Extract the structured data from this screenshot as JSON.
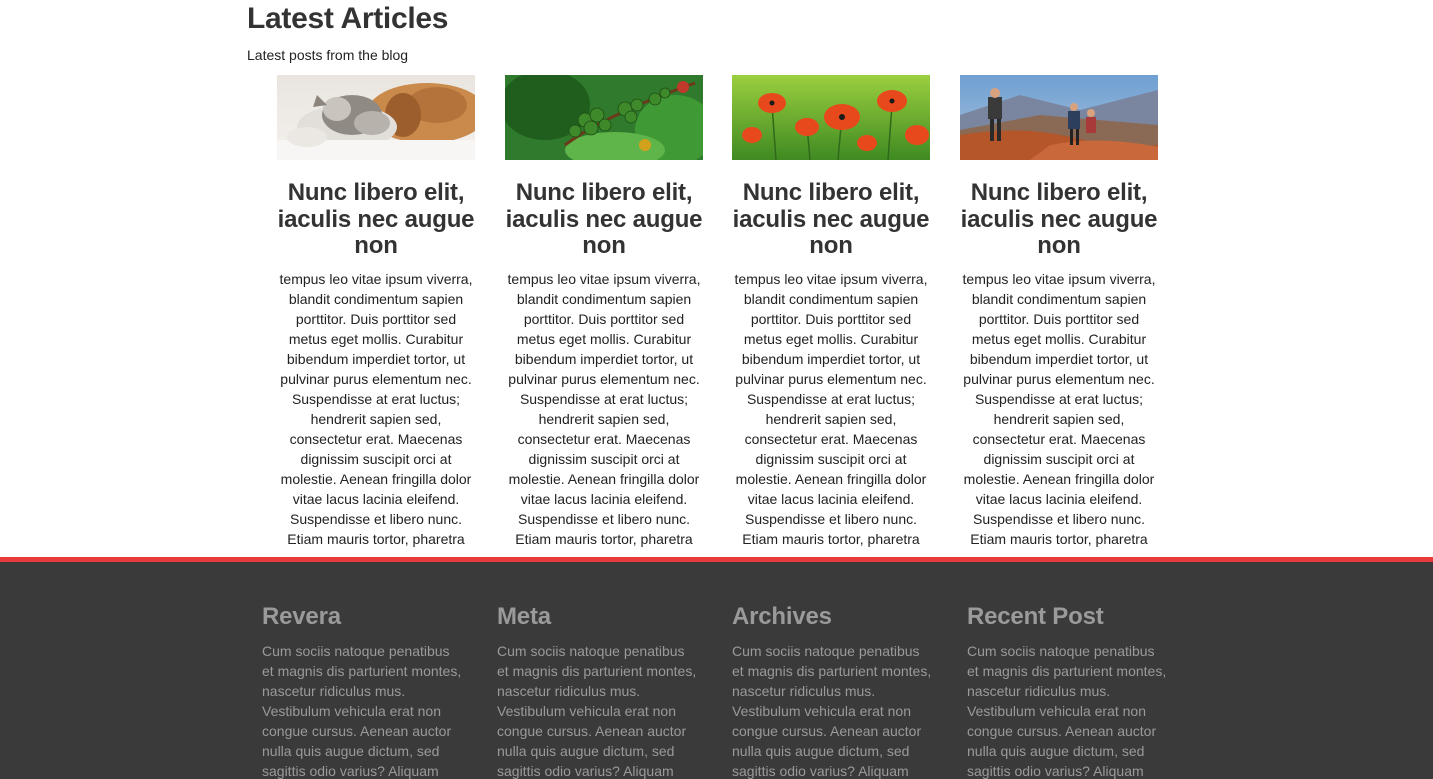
{
  "articles": {
    "title": "Latest Articles",
    "subtitle": "Latest posts from the blog",
    "cards": [
      {
        "image": "kitten-and-puppy-photo",
        "title": "Nunc libero elit, iaculis nec augue non",
        "body": "tempus leo vitae ipsum viverra,\nblandit condimentum sapien\nporttitor. Duis porttitor sed\nmetus eget mollis. Curabitur\nbibendum imperdiet tortor, ut\npulvinar purus elementum nec.\nSuspendisse at erat luctus;\nhendrerit sapien sed,\nconsectetur erat. Maecenas\ndignissim suscipit orci at\nmolestie. Aenean fringilla dolor\nvitae lacus lacinia eleifend.\nSuspendisse et libero nunc.\nEtiam mauris tortor, pharetra"
      },
      {
        "image": "green-berries-photo",
        "title": "Nunc libero elit, iaculis nec augue non",
        "body": "tempus leo vitae ipsum viverra,\nblandit condimentum sapien\nporttitor. Duis porttitor sed\nmetus eget mollis. Curabitur\nbibendum imperdiet tortor, ut\npulvinar purus elementum nec.\nSuspendisse at erat luctus;\nhendrerit sapien sed,\nconsectetur erat. Maecenas\ndignissim suscipit orci at\nmolestie. Aenean fringilla dolor\nvitae lacus lacinia eleifend.\nSuspendisse et libero nunc.\nEtiam mauris tortor, pharetra"
      },
      {
        "image": "red-poppies-photo",
        "title": "Nunc libero elit, iaculis nec augue non",
        "body": "tempus leo vitae ipsum viverra,\nblandit condimentum sapien\nporttitor. Duis porttitor sed\nmetus eget mollis. Curabitur\nbibendum imperdiet tortor, ut\npulvinar purus elementum nec.\nSuspendisse at erat luctus;\nhendrerit sapien sed,\nconsectetur erat. Maecenas\ndignissim suscipit orci at\nmolestie. Aenean fringilla dolor\nvitae lacus lacinia eleifend.\nSuspendisse et libero nunc.\nEtiam mauris tortor, pharetra"
      },
      {
        "image": "hikers-photo",
        "title": "Nunc libero elit, iaculis nec augue non",
        "body": "tempus leo vitae ipsum viverra,\nblandit condimentum sapien\nporttitor. Duis porttitor sed\nmetus eget mollis. Curabitur\nbibendum imperdiet tortor, ut\npulvinar purus elementum nec.\nSuspendisse at erat luctus;\nhendrerit sapien sed,\nconsectetur erat. Maecenas\ndignissim suscipit orci at\nmolestie. Aenean fringilla dolor\nvitae lacus lacinia eleifend.\nSuspendisse et libero nunc.\nEtiam mauris tortor, pharetra"
      }
    ]
  },
  "footer": {
    "accent_color": "#e8393b",
    "background_color": "#3a3a3a",
    "columns": [
      {
        "title": "Revera",
        "body": "Cum sociis natoque penatibus\net magnis dis parturient montes,\nnascetur ridiculus mus.\nVestibulum vehicula erat non\ncongue cursus. Aenean auctor\nnulla quis augue dictum, sed\nsagittis odio varius? Aliquam"
      },
      {
        "title": "Meta",
        "body": "Cum sociis natoque penatibus\net magnis dis parturient montes,\nnascetur ridiculus mus.\nVestibulum vehicula erat non\ncongue cursus. Aenean auctor\nnulla quis augue dictum, sed\nsagittis odio varius? Aliquam"
      },
      {
        "title": "Archives",
        "body": "Cum sociis natoque penatibus\net magnis dis parturient montes,\nnascetur ridiculus mus.\nVestibulum vehicula erat non\ncongue cursus. Aenean auctor\nnulla quis augue dictum, sed\nsagittis odio varius? Aliquam"
      },
      {
        "title": "Recent Post",
        "body": "Cum sociis natoque penatibus\net magnis dis parturient montes,\nnascetur ridiculus mus.\nVestibulum vehicula erat non\ncongue cursus. Aenean auctor\nnulla quis augue dictum, sed\nsagittis odio varius? Aliquam"
      }
    ]
  }
}
